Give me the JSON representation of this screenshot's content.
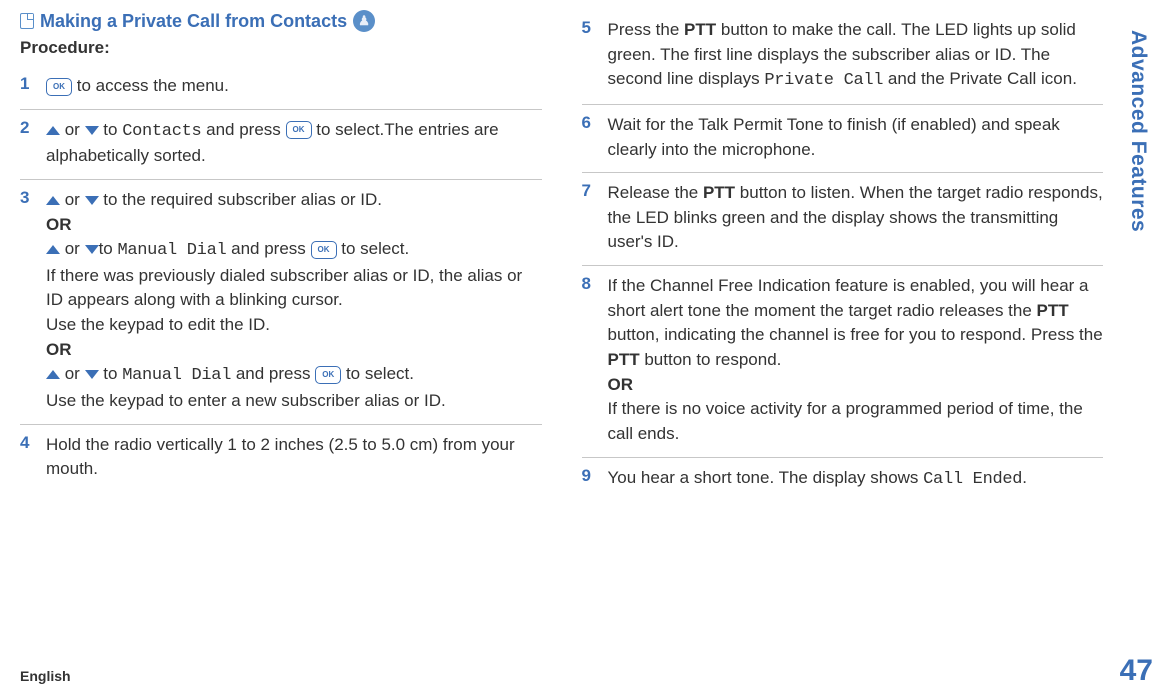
{
  "heading": "Making a Private Call from Contacts",
  "procedure_label": "Procedure:",
  "ok_label": "OK",
  "steps_left": [
    {
      "num": "1",
      "parts": [
        {
          "t": "ok"
        },
        {
          "t": "text",
          "v": " to access the menu."
        }
      ]
    },
    {
      "num": "2",
      "parts": [
        {
          "t": "up"
        },
        {
          "t": "text",
          "v": " or "
        },
        {
          "t": "down"
        },
        {
          "t": "text",
          "v": " to "
        },
        {
          "t": "mono",
          "v": "Contacts"
        },
        {
          "t": "text",
          "v": " and press "
        },
        {
          "t": "ok"
        },
        {
          "t": "text",
          "v": " to select.The entries are alphabetically sorted."
        }
      ]
    },
    {
      "num": "3",
      "parts": [
        {
          "t": "up"
        },
        {
          "t": "text",
          "v": " or "
        },
        {
          "t": "down"
        },
        {
          "t": "text",
          "v": " to the required subscriber alias or ID."
        },
        {
          "t": "br"
        },
        {
          "t": "orbold",
          "v": "OR"
        },
        {
          "t": "br"
        },
        {
          "t": "up"
        },
        {
          "t": "text",
          "v": " or "
        },
        {
          "t": "down"
        },
        {
          "t": "text",
          "v": "to "
        },
        {
          "t": "mono",
          "v": "Manual Dial"
        },
        {
          "t": "text",
          "v": " and press "
        },
        {
          "t": "ok"
        },
        {
          "t": "text",
          "v": " to select."
        },
        {
          "t": "br"
        },
        {
          "t": "text",
          "v": "If there was previously dialed subscriber alias or ID, the alias or ID appears along with a blinking cursor."
        },
        {
          "t": "br"
        },
        {
          "t": "text",
          "v": "Use the keypad to edit the ID."
        },
        {
          "t": "br"
        },
        {
          "t": "orbold",
          "v": "OR"
        },
        {
          "t": "br"
        },
        {
          "t": "up"
        },
        {
          "t": "text",
          "v": " or "
        },
        {
          "t": "down"
        },
        {
          "t": "text",
          "v": " to "
        },
        {
          "t": "mono",
          "v": "Manual Dial"
        },
        {
          "t": "text",
          "v": " and press "
        },
        {
          "t": "ok"
        },
        {
          "t": "text",
          "v": " to select."
        },
        {
          "t": "br"
        },
        {
          "t": "text",
          "v": "Use the keypad to enter a new subscriber alias or ID."
        }
      ]
    },
    {
      "num": "4",
      "parts": [
        {
          "t": "text",
          "v": "Hold the radio vertically 1 to 2 inches (2.5 to 5.0 cm) from your mouth."
        }
      ]
    }
  ],
  "steps_right": [
    {
      "num": "5",
      "parts": [
        {
          "t": "text",
          "v": "Press the "
        },
        {
          "t": "ptt",
          "v": "PTT"
        },
        {
          "t": "text",
          "v": " button to make the call. The LED lights up solid green. The first line displays the subscriber alias or ID. The second line displays "
        },
        {
          "t": "mono",
          "v": "Private Call"
        },
        {
          "t": "text",
          "v": " and the Private Call icon."
        }
      ]
    },
    {
      "num": "6",
      "parts": [
        {
          "t": "text",
          "v": "Wait for the Talk Permit Tone to finish (if enabled) and speak clearly into the microphone."
        }
      ]
    },
    {
      "num": "7",
      "parts": [
        {
          "t": "text",
          "v": "Release the "
        },
        {
          "t": "ptt",
          "v": "PTT"
        },
        {
          "t": "text",
          "v": " button to listen. When the target radio responds, the LED blinks green and the display shows the transmitting user's ID."
        }
      ]
    },
    {
      "num": "8",
      "parts": [
        {
          "t": "text",
          "v": "If the Channel Free Indication feature is enabled, you will hear a short alert tone the moment the target radio releases the "
        },
        {
          "t": "ptt",
          "v": "PTT"
        },
        {
          "t": "text",
          "v": " button, indicating the channel is free for you to respond. Press the "
        },
        {
          "t": "ptt",
          "v": "PTT"
        },
        {
          "t": "text",
          "v": " button to respond."
        },
        {
          "t": "br"
        },
        {
          "t": "orbold",
          "v": "OR"
        },
        {
          "t": "br"
        },
        {
          "t": "text",
          "v": "If there is no voice activity for a programmed period of time, the call ends."
        }
      ]
    },
    {
      "num": "9",
      "parts": [
        {
          "t": "text",
          "v": "You hear a short tone. The display shows "
        },
        {
          "t": "mono",
          "v": "Call Ended"
        },
        {
          "t": "text",
          "v": "."
        }
      ]
    }
  ],
  "side_tab": "Advanced Features",
  "page_number": "47",
  "footer_lang": "English"
}
